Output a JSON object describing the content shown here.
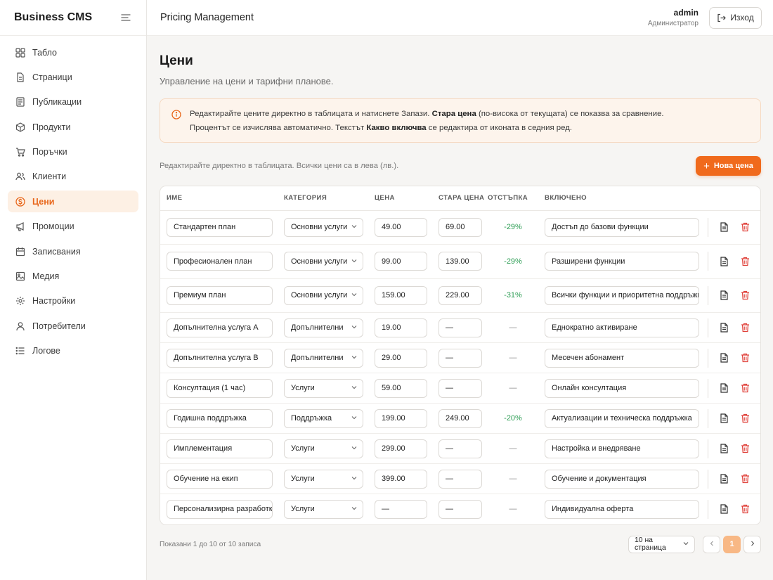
{
  "sidebar": {
    "brand": "Business CMS",
    "items": [
      {
        "label": "Табло",
        "icon": "dashboard-icon"
      },
      {
        "label": "Страници",
        "icon": "page-icon"
      },
      {
        "label": "Публикации",
        "icon": "posts-icon"
      },
      {
        "label": "Продукти",
        "icon": "box-icon"
      },
      {
        "label": "Поръчки",
        "icon": "cart-icon"
      },
      {
        "label": "Клиенти",
        "icon": "users-icon"
      },
      {
        "label": "Цени",
        "icon": "dollar-icon"
      },
      {
        "label": "Промоции",
        "icon": "megaphone-icon"
      },
      {
        "label": "Записвания",
        "icon": "calendar-icon"
      },
      {
        "label": "Медия",
        "icon": "image-icon"
      },
      {
        "label": "Настройки",
        "icon": "gear-icon"
      },
      {
        "label": "Потребители",
        "icon": "user-icon"
      },
      {
        "label": "Логове",
        "icon": "list-icon"
      }
    ],
    "active_item": "Цени"
  },
  "topbar": {
    "title": "Pricing Management",
    "user_name": "admin",
    "user_role": "Администратор",
    "logout_label": "Изход"
  },
  "page": {
    "title": "Цени",
    "subtitle": "Управление на цени и тарифни планове."
  },
  "alert": {
    "line1_a": "Редактирайте цените директно в таблицата и натиснете Запази. ",
    "line1_b": "Стара цена",
    "line1_c": " (по-висока от текущата) се показва за сравнение.",
    "line2_a": "Процентът се изчислява автоматично. Текстът ",
    "line2_b": "Какво включва",
    "line2_c": " се редактира от иконата в седния ред."
  },
  "toolbar": {
    "note": "Редактирайте директно в таблицата. Всички цени са в лева (лв.).",
    "new_label": "Нова цена"
  },
  "table": {
    "headers": {
      "name": "ИМЕ",
      "category": "КАТЕГОРИЯ",
      "price": "ЦЕНА",
      "old_price": "СТАРА ЦЕНА",
      "discount": "ОТСТЪПКА",
      "included": "ВКЛЮЧЕНО"
    },
    "rows": [
      {
        "name": "Стандартен план",
        "category": "Основни услуги",
        "price": "49.00",
        "old_price": "69.00",
        "discount": "-29%",
        "included": "Достъп до базови функции"
      },
      {
        "name": "Професионален план",
        "category": "Основни услуги",
        "price": "99.00",
        "old_price": "139.00",
        "discount": "-29%",
        "included": "Разширени функции"
      },
      {
        "name": "Премиум план",
        "category": "Основни услуги",
        "price": "159.00",
        "old_price": "229.00",
        "discount": "-31%",
        "included": "Всички функции и приоритетна поддръжка"
      },
      {
        "name": "Допълнителна услуга А",
        "category": "Допълнителни",
        "price": "19.00",
        "old_price": "—",
        "discount": "—",
        "included": "Еднократно активиране"
      },
      {
        "name": "Допълнителна услуга В",
        "category": "Допълнителни",
        "price": "29.00",
        "old_price": "—",
        "discount": "—",
        "included": "Месечен абонамент"
      },
      {
        "name": "Консултация (1 час)",
        "category": "Услуги",
        "price": "59.00",
        "old_price": "—",
        "discount": "—",
        "included": "Онлайн консултация"
      },
      {
        "name": "Годишна поддръжка",
        "category": "Поддръжка",
        "price": "199.00",
        "old_price": "249.00",
        "discount": "-20%",
        "included": "Актуализации и техническа поддръжка"
      },
      {
        "name": "Имплементация",
        "category": "Услуги",
        "price": "299.00",
        "old_price": "—",
        "discount": "—",
        "included": "Настройка и внедряване"
      },
      {
        "name": "Обучение на екип",
        "category": "Услуги",
        "price": "399.00",
        "old_price": "—",
        "discount": "—",
        "included": "Обучение и документация"
      },
      {
        "name": "Персонализирна разработка",
        "category": "Услуги",
        "price": "—",
        "old_price": "—",
        "discount": "—",
        "included": "Индивидуална оферта"
      }
    ]
  },
  "footer": {
    "info": "Показани 1 до 10 от 10 записа",
    "per_page": "10 на страница",
    "current_page": "1"
  },
  "colors": {
    "accent": "#f06a1c",
    "accent_soft": "#fdf0e4",
    "discount_green": "#2e9e55",
    "delete_red": "#e0413a"
  }
}
